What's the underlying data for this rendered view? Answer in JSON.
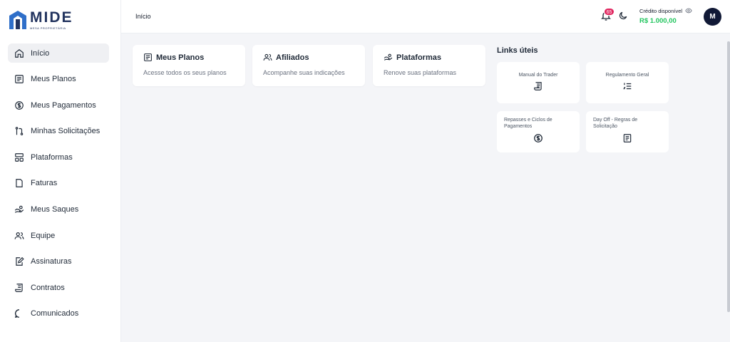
{
  "brand": {
    "name": "MIDE",
    "subtitle": "MESA PROPRIETÁRIA",
    "color": "#23345f"
  },
  "header": {
    "breadcrumb": "Início",
    "notifications_count": "65",
    "credit_label": "Crédito disponível",
    "credit_value": "R$ 1.000,00",
    "avatar_initial": "M"
  },
  "sidebar": {
    "items": [
      {
        "label": "Início",
        "icon": "home-icon",
        "active": true
      },
      {
        "label": "Meus Planos",
        "icon": "list-doc-icon"
      },
      {
        "label": "Meus Pagamentos",
        "icon": "dollar-circle-icon"
      },
      {
        "label": "Minhas Solicitações",
        "icon": "git-pull-icon"
      },
      {
        "label": "Plataformas",
        "icon": "layout-icon"
      },
      {
        "label": "Faturas",
        "icon": "file-icon"
      },
      {
        "label": "Meus Saques",
        "icon": "hand-coins-icon"
      },
      {
        "label": "Equipe",
        "icon": "users-icon"
      },
      {
        "label": "Assinaturas",
        "icon": "signature-icon"
      },
      {
        "label": "Contratos",
        "icon": "scroll-icon"
      },
      {
        "label": "Comunicados",
        "icon": "chat-icon"
      }
    ]
  },
  "cards": [
    {
      "title": "Meus Planos",
      "desc": "Acesse todos os seus planos",
      "icon": "list-doc-icon"
    },
    {
      "title": "Afiliados",
      "desc": "Acompanhe suas indicações",
      "icon": "users-icon"
    },
    {
      "title": "Plataformas",
      "desc": "Renove suas plataformas",
      "icon": "hand-coins-icon"
    }
  ],
  "links": {
    "title": "Links úteis",
    "items": [
      {
        "label": "Manual do Trader",
        "icon": "scroll-list-icon"
      },
      {
        "label": "Regulamento Geral",
        "icon": "ordered-list-icon"
      },
      {
        "label": "Repasses e Ciclos de Pagamentos",
        "icon": "dollar-circle-icon"
      },
      {
        "label": "Day Off - Regras de Solicitação",
        "icon": "document-icon"
      }
    ]
  },
  "colors": {
    "accent_green": "#22c55e",
    "badge": "#e0245e",
    "avatar_bg": "#111936"
  }
}
